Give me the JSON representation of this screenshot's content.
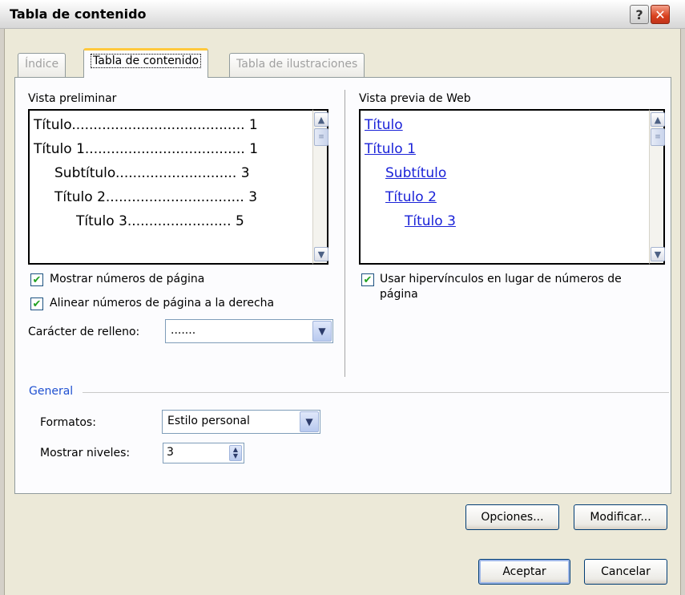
{
  "window": {
    "title": "Tabla de contenido",
    "help_glyph": "?",
    "close_glyph": "✕"
  },
  "tabs": [
    {
      "label": "Índice",
      "active": false
    },
    {
      "label": "Tabla de contenido",
      "active": true
    },
    {
      "label": "Tabla de ilustraciones",
      "active": false
    }
  ],
  "print_preview": {
    "label": "Vista preliminar",
    "lines": [
      {
        "text": "Título........................................ 1"
      },
      {
        "text": "Título 1..................................... 1"
      },
      {
        "text": "Subtítulo............................ 3"
      },
      {
        "text": "Título 2................................ 3"
      },
      {
        "text": "Título 3........................ 5"
      }
    ]
  },
  "web_preview": {
    "label": "Vista previa de Web",
    "lines": [
      "Título",
      "Título 1",
      "Subtítulo",
      "Título 2",
      "Título 3"
    ]
  },
  "options": {
    "show_page_numbers": {
      "label": "Mostrar números de página",
      "checked": true
    },
    "right_align": {
      "label": "Alinear números de página a la derecha",
      "checked": true
    },
    "use_hyperlinks": {
      "label_line1": "Usar hipervínculos en lugar de números de",
      "label_line2": "página",
      "checked": true
    },
    "tab_leader": {
      "label": "Carácter de relleno:",
      "value": "......."
    }
  },
  "general": {
    "heading": "General",
    "formats": {
      "label": "Formatos:",
      "value": "Estilo personal"
    },
    "levels": {
      "label": "Mostrar niveles:",
      "value": "3"
    }
  },
  "buttons": {
    "options": "Opciones...",
    "modify": "Modificar...",
    "ok": "Aceptar",
    "cancel": "Cancelar"
  },
  "glyphs": {
    "check": "✔",
    "up": "▲",
    "down": "▼",
    "grip": "≡"
  }
}
